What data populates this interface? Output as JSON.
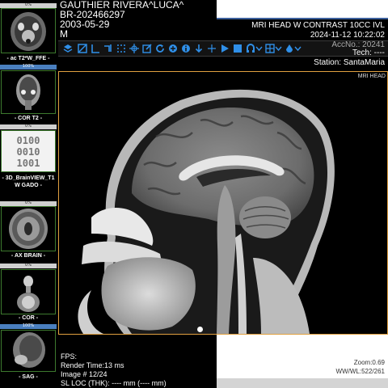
{
  "series": [
    {
      "label": "- ac T2*W_FFE -",
      "progress_text": "0%",
      "progress": 0
    },
    {
      "label": "- COR T2 -",
      "progress_text": "100%",
      "progress": 1
    },
    {
      "label": "- 3D_BrainVIEW_T1 W GADO -",
      "progress_text": "0%",
      "progress": 0,
      "placeholder_digits": [
        "0100",
        "0010",
        "1001"
      ]
    },
    {
      "label": "- AX BRAIN -",
      "progress_text": "0%",
      "progress": 0
    },
    {
      "label": "- COR -",
      "progress_text": "0%",
      "progress": 0
    },
    {
      "label": "- SAG -",
      "progress_text": "100%",
      "progress": 1
    }
  ],
  "patient": {
    "name": "GAUTHIER RIVERA^LUCA^",
    "id": "BR-202466297",
    "dob": "2003-05-29",
    "sex": "M"
  },
  "study": {
    "description": "MRI HEAD W CONTRAST 10CC IVL",
    "datetime": "2024-11-12 10:22:02",
    "accession": "AccNo.: 20241",
    "tech": "Tech: ----",
    "station": "Station: SantaMaria"
  },
  "toolbar": {
    "icons": [
      "layers-icon",
      "windowing-icon",
      "measure-line-icon",
      "angle-icon",
      "dotted-select-icon",
      "crosshair-icon",
      "annotate-icon",
      "reset-icon",
      "pan-icon",
      "info-icon",
      "arrow-down-icon",
      "crosshair-plus-icon",
      "play-icon",
      "stop-icon",
      "link-icon",
      "dropdown-icon",
      "grid-icon",
      "dropdown-icon",
      "color-icon",
      "dropdown-icon"
    ]
  },
  "viewport": {
    "overlay_label": "MRI HEAD"
  },
  "bottom": {
    "fps": "FPS:",
    "render_time": "Render Time:13 ms",
    "image_index": "Image # 12/24",
    "slice_loc": "SL LOC (THK): ---- mm (---- mm)",
    "zoom": "Zoom:0.69",
    "wwwl": "WW/WL:522/261"
  },
  "colors": {
    "accent_blue": "#2f8fe8",
    "progress_fill": "#4a7fbf",
    "thumb_border": "#3d7a2e",
    "viewport_border": "#e0a040"
  }
}
